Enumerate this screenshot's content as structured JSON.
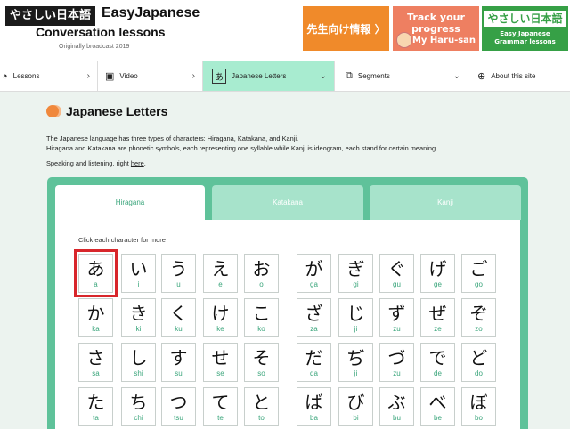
{
  "header": {
    "logo_jp": "やさしい日本語",
    "logo_en": "EasyJapanese",
    "logo_sub": "Conversation lessons",
    "logo_note": "Originally broadcast 2019",
    "banner_teacher": "先生向け情報 〉",
    "banner_progress_1": "Track your",
    "banner_progress_2": "progress",
    "banner_progress_3": "My Haru-san",
    "banner_grammar_kana": "やさしい日本語",
    "banner_grammar_1": "Easy Japanese",
    "banner_grammar_2": "Grammar lessons"
  },
  "nav": {
    "lessons": "Lessons",
    "video": "Video",
    "letters": "Japanese Letters",
    "letters_icon": "あ",
    "segments": "Segments",
    "about": "About this site"
  },
  "main": {
    "title": "Japanese Letters",
    "p1": "The Japanese language has three types of characters: Hiragana, Katakana, and Kanji.",
    "p2": "Hiragana and Katakana are phonetic symbols, each representing one syllable while Kanji is ideogram, each stand for certain meaning.",
    "p3_text": "Speaking and listening, right ",
    "p3_link": "here",
    "p3_end": "."
  },
  "tabs": {
    "hiragana": "Hiragana",
    "katakana": "Katakana",
    "kanji": "Kanji"
  },
  "hint": "Click each character for more",
  "chars": [
    {
      "k": "あ",
      "r": "a"
    },
    {
      "k": "い",
      "r": "i"
    },
    {
      "k": "う",
      "r": "u"
    },
    {
      "k": "え",
      "r": "e"
    },
    {
      "k": "お",
      "r": "o"
    },
    {
      "k": "が",
      "r": "ga"
    },
    {
      "k": "ぎ",
      "r": "gi"
    },
    {
      "k": "ぐ",
      "r": "gu"
    },
    {
      "k": "げ",
      "r": "ge"
    },
    {
      "k": "ご",
      "r": "go"
    },
    {
      "k": "か",
      "r": "ka"
    },
    {
      "k": "き",
      "r": "ki"
    },
    {
      "k": "く",
      "r": "ku"
    },
    {
      "k": "け",
      "r": "ke"
    },
    {
      "k": "こ",
      "r": "ko"
    },
    {
      "k": "ざ",
      "r": "za"
    },
    {
      "k": "じ",
      "r": "ji"
    },
    {
      "k": "ず",
      "r": "zu"
    },
    {
      "k": "ぜ",
      "r": "ze"
    },
    {
      "k": "ぞ",
      "r": "zo"
    },
    {
      "k": "さ",
      "r": "sa"
    },
    {
      "k": "し",
      "r": "shi"
    },
    {
      "k": "す",
      "r": "su"
    },
    {
      "k": "せ",
      "r": "se"
    },
    {
      "k": "そ",
      "r": "so"
    },
    {
      "k": "だ",
      "r": "da"
    },
    {
      "k": "ぢ",
      "r": "ji"
    },
    {
      "k": "づ",
      "r": "zu"
    },
    {
      "k": "で",
      "r": "de"
    },
    {
      "k": "ど",
      "r": "do"
    },
    {
      "k": "た",
      "r": "ta"
    },
    {
      "k": "ち",
      "r": "chi"
    },
    {
      "k": "つ",
      "r": "tsu"
    },
    {
      "k": "て",
      "r": "te"
    },
    {
      "k": "と",
      "r": "to"
    },
    {
      "k": "ば",
      "r": "ba"
    },
    {
      "k": "び",
      "r": "bi"
    },
    {
      "k": "ぶ",
      "r": "bu"
    },
    {
      "k": "べ",
      "r": "be"
    },
    {
      "k": "ぼ",
      "r": "bo"
    }
  ]
}
